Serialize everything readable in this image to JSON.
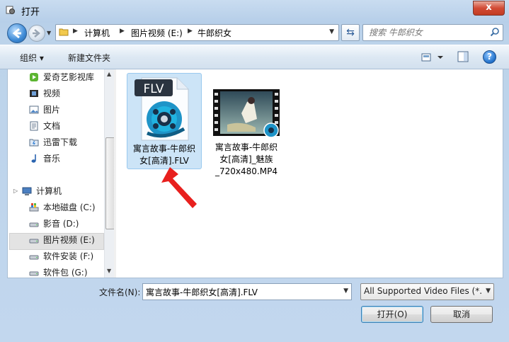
{
  "window": {
    "title": "打开",
    "close_label": "x"
  },
  "nav": {
    "breadcrumbs": [
      "计算机",
      "图片视频 (E:)",
      "牛郎织女"
    ],
    "search_placeholder": "搜索 牛郎织女"
  },
  "toolbar": {
    "organize_label": "组织 ▾",
    "new_folder_label": "新建文件夹",
    "help_label": "?"
  },
  "sidebar": {
    "items": [
      {
        "label": "爱奇艺影视库",
        "icon": "iqiyi-icon"
      },
      {
        "label": "视频",
        "icon": "video-library-icon"
      },
      {
        "label": "图片",
        "icon": "pictures-library-icon"
      },
      {
        "label": "文档",
        "icon": "documents-library-icon"
      },
      {
        "label": "迅雷下载",
        "icon": "thunder-download-icon"
      },
      {
        "label": "音乐",
        "icon": "music-library-icon"
      },
      {
        "label": "计算机",
        "icon": "computer-icon"
      },
      {
        "label": "本地磁盘 (C:)",
        "icon": "system-drive-icon"
      },
      {
        "label": "影音 (D:)",
        "icon": "drive-icon"
      },
      {
        "label": "图片视频 (E:)",
        "icon": "drive-icon"
      },
      {
        "label": "软件安装 (F:)",
        "icon": "drive-icon"
      },
      {
        "label": "软件包 (G:)",
        "icon": "drive-icon"
      }
    ],
    "selected": "图片视频 (E:)"
  },
  "files": [
    {
      "name_lines": [
        "寓言故事-牛郎织",
        "女[高清].FLV"
      ],
      "badge": "FLV",
      "selected": true,
      "icon": "flv-file-icon"
    },
    {
      "name_lines": [
        "寓言故事-牛郎织",
        "女[高清]_魅族",
        "_720x480.MP4"
      ],
      "selected": false,
      "icon": "mp4-video-thumbnail-icon"
    }
  ],
  "bottom": {
    "filename_label": "文件名(N):",
    "filename_value": "寓言故事-牛郎织女[高清].FLV",
    "filetype_value": "All Supported Video Files (*.",
    "open_label": "打开(O)",
    "cancel_label": "取消"
  },
  "colors": {
    "selection_bg": "#cce4f7",
    "close_red": "#d24b35",
    "annotation_arrow": "#e8201e"
  }
}
